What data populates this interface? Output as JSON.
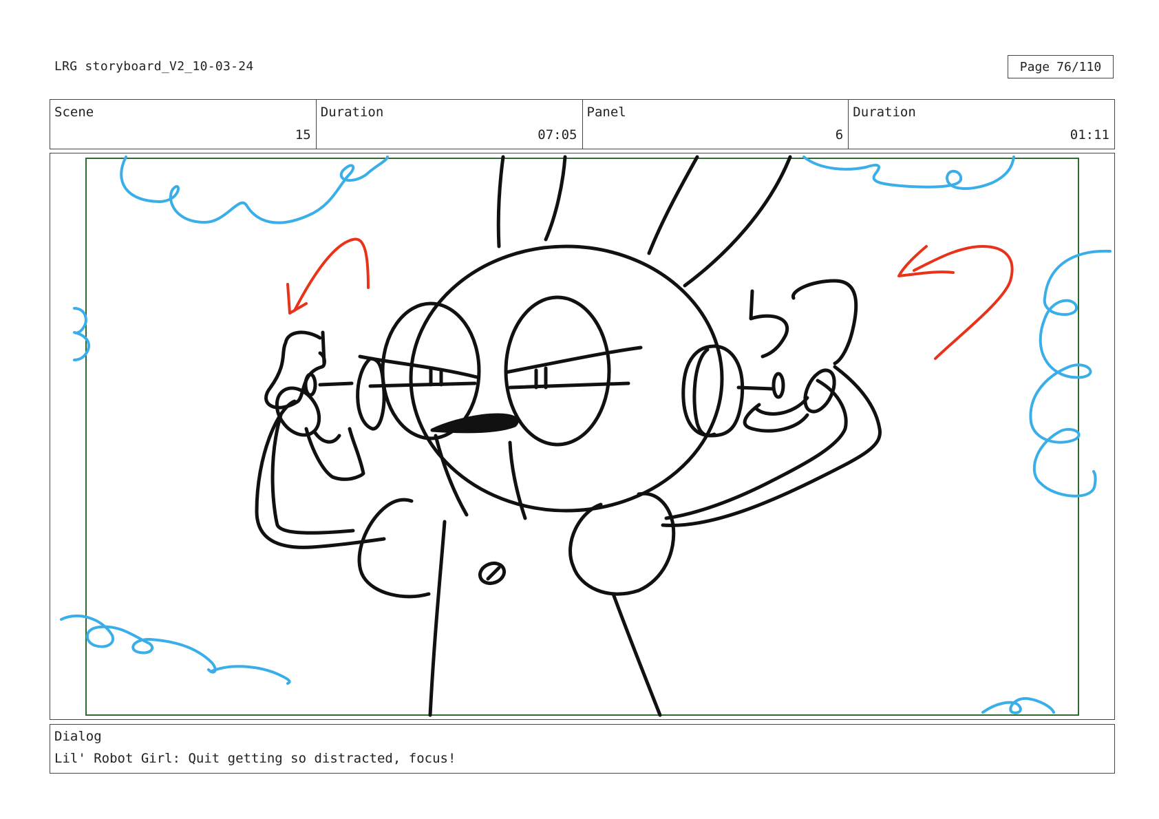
{
  "document": {
    "title": "LRG storyboard_V2_10-03-24"
  },
  "page": {
    "label": "Page",
    "number": "76/110"
  },
  "info": {
    "scene_label": "Scene",
    "scene_value": "15",
    "scene_duration_label": "Duration",
    "scene_duration_value": "07:05",
    "panel_label": "Panel",
    "panel_value": "6",
    "panel_duration_label": "Duration",
    "panel_duration_value": "01:11"
  },
  "frame": {
    "colors": {
      "lineart": "#111111",
      "clouds": "#3aaee8",
      "motion_arrows": "#e8331a",
      "safe_frame": "#2e6b2e"
    }
  },
  "dialog": {
    "label": "Dialog",
    "text": "Lil' Robot Girl: Quit getting so distracted, focus!"
  }
}
